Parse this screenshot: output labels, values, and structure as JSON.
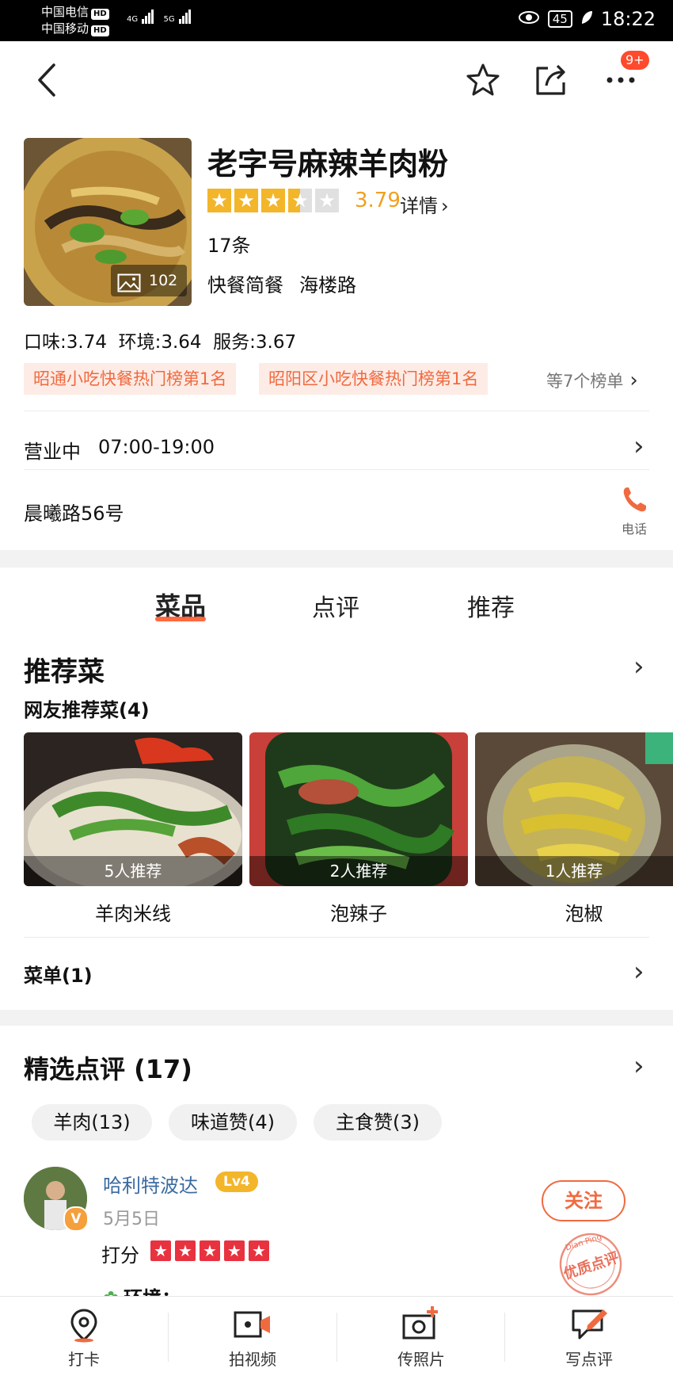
{
  "status_bar": {
    "carrier1": "中国电信",
    "carrier2": "中国移动",
    "hd": "HD",
    "net1": "4G",
    "net2": "5G",
    "battery": "45",
    "time": "18:22"
  },
  "header": {
    "notification_badge": "9+"
  },
  "shop": {
    "name": "老字号麻辣羊肉粉",
    "photo_count": "102",
    "rating": "3.79",
    "rating_stars": 3.5,
    "detail_link": "详情",
    "review_count": "17条",
    "category": "快餐简餐",
    "area": "海楼路",
    "scores": "口味:3.74  环境:3.64  服务:3.67",
    "rank_tags": [
      "昭通小吃快餐热门榜第1名",
      "昭阳区小吃快餐热门榜第1名"
    ],
    "more_ranks": "等7个榜单",
    "hours_status": "营业中",
    "hours": "07:00-19:00",
    "address": "晨曦路56号",
    "phone_label": "电话",
    "accent_color": "#f06a40"
  },
  "tabs": [
    "菜品",
    "点评",
    "推荐"
  ],
  "recommended": {
    "title": "推荐菜",
    "subtitle": "网友推荐菜(4)",
    "dishes": [
      {
        "name": "羊肉米线",
        "recommend": "5人推荐"
      },
      {
        "name": "泡辣子",
        "recommend": "2人推荐"
      },
      {
        "name": "泡椒",
        "recommend": "1人推荐"
      }
    ],
    "menu_label": "菜单(1)"
  },
  "reviews": {
    "title": "精选点评 (17)",
    "chips": [
      "羊肉(13)",
      "味道赞(4)",
      "主食赞(3)"
    ],
    "first": {
      "user": "哈利特波达",
      "level": "Lv4",
      "date": "5月5日",
      "score_label": "打分",
      "score_stars": 5,
      "follow": "关注",
      "stamp_text": "优质点评",
      "stamp_top": "Dian Ping",
      "preview": "环境："
    }
  },
  "bottom_bar": [
    "打卡",
    "拍视频",
    "传照片",
    "写点评"
  ]
}
